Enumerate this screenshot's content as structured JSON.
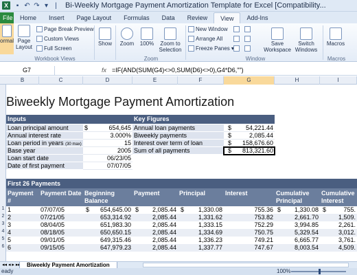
{
  "window": {
    "title": "Bi-Weekly Mortgage Payment Amortization Template for Excel  [Compatibility..."
  },
  "tabs": [
    "File",
    "Home",
    "Insert",
    "Page Layout",
    "Formulas",
    "Data",
    "Review",
    "View",
    "Add-Ins"
  ],
  "ribbon": {
    "normal": "ormal",
    "page_layout": "Page Layout",
    "page_break": "Page Break Preview",
    "custom_views": "Custom Views",
    "full_screen": "Full Screen",
    "show": "Show",
    "zoom": "Zoom",
    "zoom100": "100%",
    "zoom_sel": "Zoom to Selection",
    "new_window": "New Window",
    "arrange_all": "Arrange All",
    "freeze": "Freeze Panes",
    "save_ws": "Save Workspace",
    "switch": "Switch Windows",
    "macros": "Macros",
    "grp_views": "Workbook Views",
    "grp_zoom": "Zoom",
    "grp_window": "Window",
    "grp_macros": "Macros"
  },
  "formula_bar": {
    "cell": "G7",
    "fx": "fx",
    "formula": "=IF(AND(SUM(G4)<>0,SUM(D6)<>0),G4*D6,\"\")"
  },
  "columns": [
    "B",
    "C",
    "D",
    "E",
    "F",
    "G",
    "H",
    "I"
  ],
  "rows": [
    "1",
    "2",
    "3",
    "4",
    "5",
    "6",
    "7",
    "8",
    "9",
    "10",
    "",
    "",
    "",
    "",
    "",
    "",
    "",
    "1",
    "2",
    "3",
    "4",
    "5",
    "6"
  ],
  "sheet": {
    "title": "Biweekly Mortgage Payment Amortization",
    "inputs_hdr": "Inputs",
    "key_hdr": "Key Figures",
    "inputs": [
      {
        "label": "Loan principal amount",
        "cur": "$",
        "value": "654,645"
      },
      {
        "label": "Annual interest rate",
        "cur": "",
        "value": "3.000%"
      },
      {
        "label": "Loan period in years",
        "note": "(30 max)",
        "cur": "",
        "value": "15"
      },
      {
        "label": "Base year",
        "cur": "",
        "value": "2005"
      },
      {
        "label": "Loan start date",
        "cur": "",
        "value": "06/23/05"
      },
      {
        "label": "Date of first payment",
        "cur": "",
        "value": "07/07/05"
      }
    ],
    "key_figures": [
      {
        "label": "Annual loan payments",
        "cur": "$",
        "value": "54,221.44"
      },
      {
        "label": "Biweekly payments",
        "cur": "$",
        "value": "2,085.44"
      },
      {
        "label": "Interest over term of loan",
        "cur": "$",
        "value": "158,676.60"
      },
      {
        "label": "Sum of all payments",
        "cur": "$",
        "value": "813,321.60"
      }
    ],
    "payments_hdr": "First 26 Payments",
    "table_headers": [
      "Payment #",
      "Payment Date",
      "Beginning Balance",
      "Payment",
      "Principal",
      "Interest",
      "Cumulative Principal",
      "Cumulative Interest"
    ],
    "table_rows": [
      [
        "1",
        "07/07/05",
        "654,645.00",
        "2,085.44",
        "1,330.08",
        "755.36",
        "1,330.08",
        "755."
      ],
      [
        "2",
        "07/21/05",
        "653,314.92",
        "2,085.44",
        "1,331.62",
        "753.82",
        "2,661.70",
        "1,509."
      ],
      [
        "3",
        "08/04/05",
        "651,983.30",
        "2,085.44",
        "1,333.15",
        "752.29",
        "3,994.85",
        "2,261."
      ],
      [
        "4",
        "08/18/05",
        "650,650.15",
        "2,085.44",
        "1,334.69",
        "750.75",
        "5,329.54",
        "3,012."
      ],
      [
        "5",
        "09/01/05",
        "649,315.46",
        "2,085.44",
        "1,336.23",
        "749.21",
        "6,665.77",
        "3,761."
      ],
      [
        "6",
        "09/15/05",
        "647,979.23",
        "2,085.44",
        "1,337.77",
        "747.67",
        "8,003.54",
        "4,509."
      ]
    ]
  },
  "sheet_tab": "Biweekly Payment Amortization",
  "status": {
    "left": "eady",
    "zoom": "100%"
  }
}
